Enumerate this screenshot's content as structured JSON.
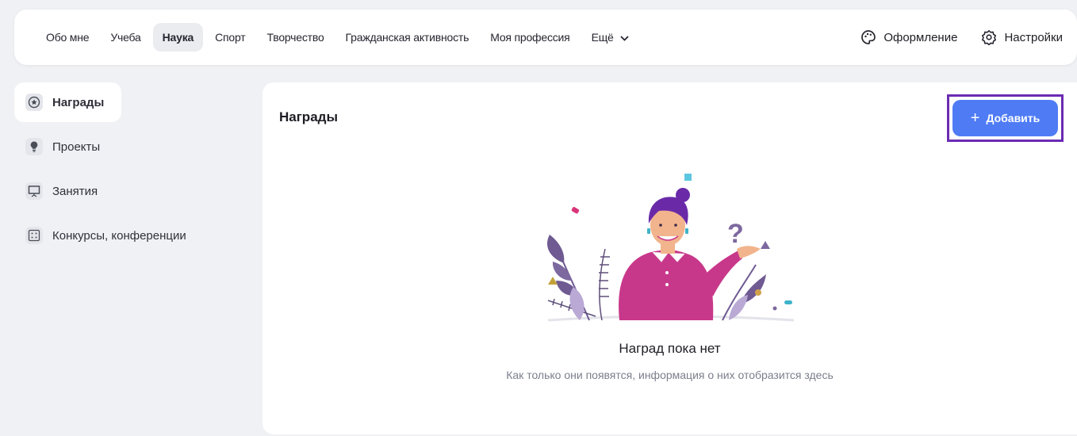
{
  "topnav": {
    "tabs": [
      {
        "label": "Обо мне"
      },
      {
        "label": "Учеба"
      },
      {
        "label": "Наука"
      },
      {
        "label": "Спорт"
      },
      {
        "label": "Творчество"
      },
      {
        "label": "Гражданская активность"
      },
      {
        "label": "Моя профессия"
      },
      {
        "label": "Ещё"
      }
    ],
    "active_tab": "Наука",
    "appearance_label": "Оформление",
    "settings_label": "Настройки"
  },
  "sidebar": {
    "items": [
      {
        "label": "Награды",
        "icon": "award-icon",
        "active": true
      },
      {
        "label": "Проекты",
        "icon": "lightbulb-icon"
      },
      {
        "label": "Занятия",
        "icon": "presentation-board-icon"
      },
      {
        "label": "Конкурсы, конференции",
        "icon": "grid-dots-icon"
      }
    ]
  },
  "main": {
    "title": "Награды",
    "add_button_label": "Добавить",
    "empty_title": "Наград пока нет",
    "empty_subtitle": "Как только они появятся, информация о них отобразится здесь"
  },
  "colors": {
    "accent": "#4f7cf5",
    "highlight_frame": "#6b2bb3",
    "background": "#f0f1f4"
  }
}
